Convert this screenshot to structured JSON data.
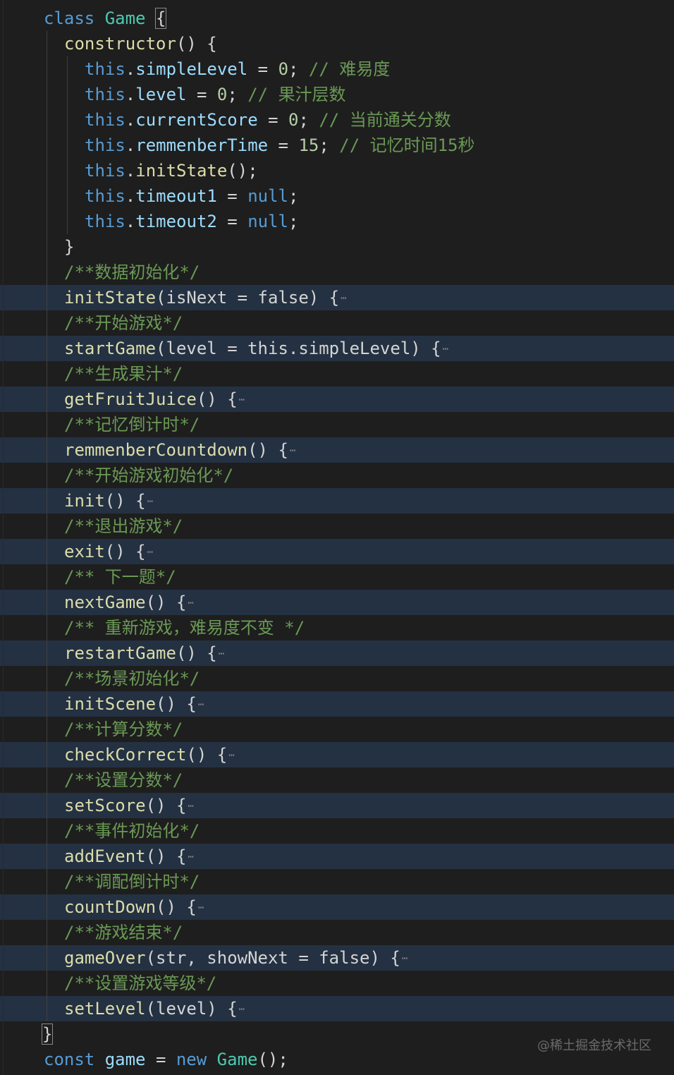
{
  "theme": {
    "background": "#1e1e1e",
    "highlight_row": "#243142",
    "keyword": "#569cd6",
    "class_name": "#4ec9b0",
    "function": "#dcdcaa",
    "variable": "#9cdcfe",
    "number": "#b5cea8",
    "comment": "#6a9955",
    "fold_icon": "ellipsis-fold-icon"
  },
  "code": {
    "class_header": {
      "kw": "class",
      "name": "Game",
      "brace": "{"
    },
    "constructor": {
      "name": "constructor",
      "sig": "() {",
      "close": "}"
    },
    "ctor_lines": [
      {
        "obj": "this",
        "prop": "simpleLevel",
        "op": " = ",
        "val": "0",
        "end": ";",
        "comment": " // 难易度"
      },
      {
        "obj": "this",
        "prop": "level",
        "op": " = ",
        "val": "0",
        "end": ";",
        "comment": " // 果汁层数"
      },
      {
        "obj": "this",
        "prop": "currentScore",
        "op": " = ",
        "val": "0",
        "end": ";",
        "comment": " // 当前通关分数"
      },
      {
        "obj": "this",
        "prop": "remmenberTime",
        "op": " = ",
        "val": "15",
        "end": ";",
        "comment": " // 记忆时间15秒"
      },
      {
        "obj": "this",
        "prop": "initState",
        "op": "();",
        "val": "",
        "end": "",
        "comment": ""
      },
      {
        "obj": "this",
        "prop": "timeout1",
        "op": " = ",
        "val": "null",
        "end": ";",
        "comment": ""
      },
      {
        "obj": "this",
        "prop": "timeout2",
        "op": " = ",
        "val": "null",
        "end": ";",
        "comment": ""
      }
    ],
    "methods": [
      {
        "comment": "/**数据初始化*/",
        "name": "initState",
        "params": "(isNext = false) {"
      },
      {
        "comment": "/**开始游戏*/",
        "name": "startGame",
        "params": "(level = this.simpleLevel) {"
      },
      {
        "comment": "/**生成果汁*/",
        "name": "getFruitJuice",
        "params": "() {"
      },
      {
        "comment": "/**记忆倒计时*/",
        "name": "remmenberCountdown",
        "params": "() {"
      },
      {
        "comment": "/**开始游戏初始化*/",
        "name": "init",
        "params": "() {"
      },
      {
        "comment": "/**退出游戏*/",
        "name": "exit",
        "params": "() {"
      },
      {
        "comment": "/** 下一题*/",
        "name": "nextGame",
        "params": "() {"
      },
      {
        "comment": "/** 重新游戏，难易度不变 */",
        "name": "restartGame",
        "params": "() {"
      },
      {
        "comment": "/**场景初始化*/",
        "name": "initScene",
        "params": "() {"
      },
      {
        "comment": "/**计算分数*/",
        "name": "checkCorrect",
        "params": "() {"
      },
      {
        "comment": "/**设置分数*/",
        "name": "setScore",
        "params": "() {"
      },
      {
        "comment": "/**事件初始化*/",
        "name": "addEvent",
        "params": "() {"
      },
      {
        "comment": "/**调配倒计时*/",
        "name": "countDown",
        "params": "() {"
      },
      {
        "comment": "/**游戏结束*/",
        "name": "gameOver",
        "params": "(str, showNext = false) {"
      },
      {
        "comment": "/**设置游戏等级*/",
        "name": "setLevel",
        "params": "(level) {"
      }
    ],
    "class_close": "}",
    "last_line": {
      "kw": "const",
      "var": "game",
      "op": " = ",
      "new": "new",
      "cls": "Game",
      "end": "();"
    },
    "fold_marker": "⋯"
  },
  "watermark": "@稀土掘金技术社区"
}
